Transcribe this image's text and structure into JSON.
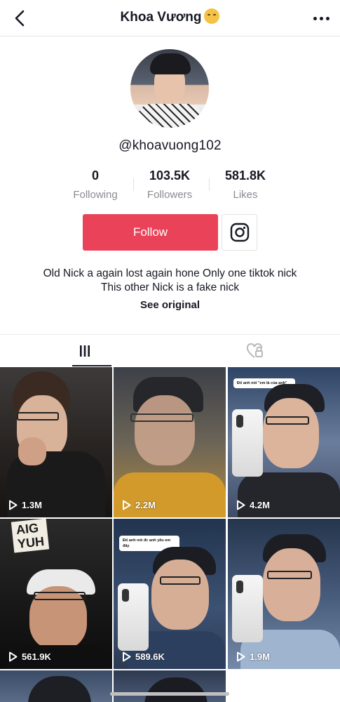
{
  "header": {
    "title": "Khoa Vương",
    "title_emoji": "woozy-face-emoji"
  },
  "profile": {
    "username": "@khoavuong102",
    "stats": [
      {
        "value": "0",
        "label": "Following"
      },
      {
        "value": "103.5K",
        "label": "Followers"
      },
      {
        "value": "581.8K",
        "label": "Likes"
      }
    ],
    "follow_label": "Follow",
    "bio_line1": "Old Nick a again lost again hone Only one tiktok nick",
    "bio_line2": "This other Nick is a fake nick",
    "see_original": "See original"
  },
  "tabs": [
    {
      "icon": "videos-grid-icon",
      "active": true
    },
    {
      "icon": "liked-videos-icon",
      "active": false
    }
  ],
  "videos": [
    {
      "views": "1.3M"
    },
    {
      "views": "2.2M"
    },
    {
      "views": "4.2M"
    },
    {
      "views": "561.9K"
    },
    {
      "views": "589.6K"
    },
    {
      "views": "1.9M"
    }
  ],
  "thumbnail_text": {
    "v3_bubble": "Đố anh nói \"em là của anh\"",
    "v4_sign_1": "AIG",
    "v4_sign_2": "YUH",
    "v5_bubble_1": "Đố anh nói đc anh yêu em",
    "v5_bubble_2": "đây"
  },
  "colors": {
    "accent": "#ea4359",
    "text": "#161823",
    "muted": "#8a8b91"
  }
}
